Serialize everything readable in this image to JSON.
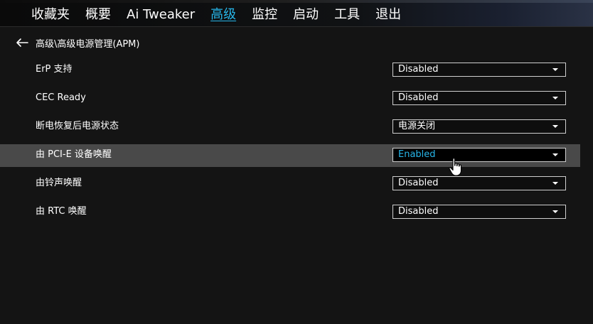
{
  "nav": {
    "items": [
      "收藏夹",
      "概要",
      "Ai Tweaker",
      "高级",
      "监控",
      "启动",
      "工具",
      "退出"
    ],
    "active_index": 3
  },
  "breadcrumb": "高级\\高级电源管理(APM)",
  "settings": [
    {
      "label": "ErP 支持",
      "value": "Disabled"
    },
    {
      "label": "CEC Ready",
      "value": "Disabled"
    },
    {
      "label": "断电恢复后电源状态",
      "value": "电源关闭"
    },
    {
      "label": "由 PCI-E 设备唤醒",
      "value": "Enabled",
      "selected": true
    },
    {
      "label": "由铃声唤醒",
      "value": "Disabled"
    },
    {
      "label": "由 RTC 唤醒",
      "value": "Disabled"
    }
  ],
  "colors": {
    "accent": "#27b5e8",
    "background": "#141414",
    "selected_row": "#494949"
  },
  "icons": {
    "back": "arrow-left-icon",
    "dropdown": "chevron-down-icon",
    "cursor": "hand-pointer-icon"
  }
}
